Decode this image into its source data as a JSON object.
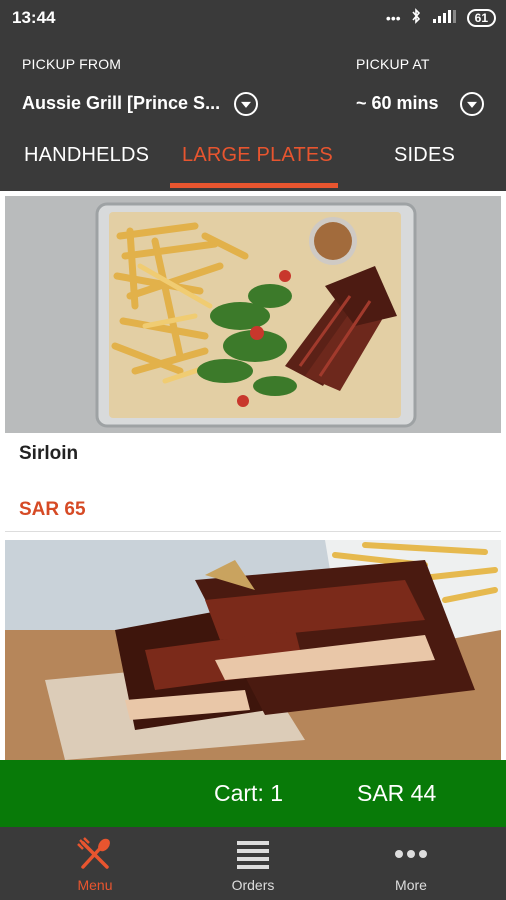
{
  "status": {
    "time": "13:44",
    "battery": "61"
  },
  "header": {
    "pickup_from_label": "PICKUP FROM",
    "pickup_from_value": "Aussie Grill [Prince S...",
    "pickup_at_label": "PICKUP AT",
    "pickup_at_value": "~ 60 mins"
  },
  "tabs": [
    {
      "label": "HANDHELDS",
      "active": false
    },
    {
      "label": "LARGE PLATES",
      "active": true
    },
    {
      "label": "SIDES",
      "active": false
    }
  ],
  "items": [
    {
      "name": "Sirloin",
      "price": "SAR 65"
    }
  ],
  "cart": {
    "count_label": "Cart: 1",
    "total": "SAR 44"
  },
  "nav": [
    {
      "label": "Menu",
      "active": true,
      "icon": "fork-knife-icon"
    },
    {
      "label": "Orders",
      "active": false,
      "icon": "list-icon"
    },
    {
      "label": "More",
      "active": false,
      "icon": "more-dots-icon"
    }
  ],
  "colors": {
    "accent": "#e8552f",
    "cart_bar": "#087a08",
    "header_bg": "#3a3a3a"
  }
}
